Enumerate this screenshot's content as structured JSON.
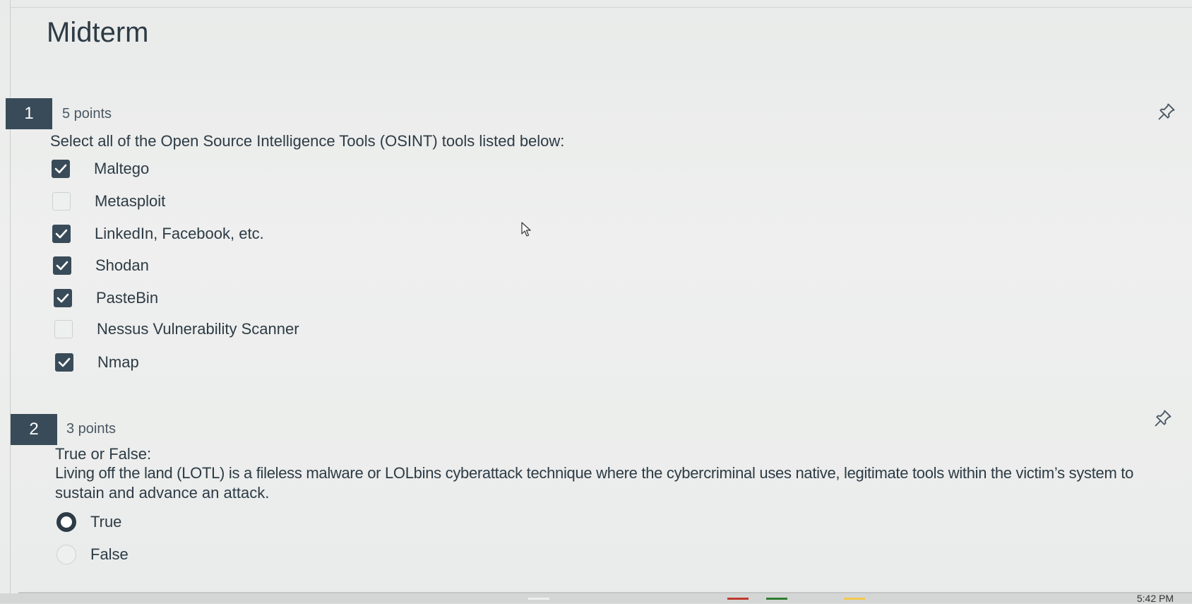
{
  "quiz": {
    "title": "Midterm"
  },
  "questions": [
    {
      "number": "1",
      "points": "5 points",
      "prompt": "Select all of the Open Source Intelligence Tools (OSINT) tools listed below:",
      "type": "checkbox",
      "options": [
        {
          "label": "Maltego",
          "checked": true
        },
        {
          "label": "Metasploit",
          "checked": false
        },
        {
          "label": "LinkedIn, Facebook, etc.",
          "checked": true
        },
        {
          "label": "Shodan",
          "checked": true
        },
        {
          "label": "PasteBin",
          "checked": true
        },
        {
          "label": "Nessus Vulnerability Scanner",
          "checked": false
        },
        {
          "label": "Nmap",
          "checked": true
        }
      ]
    },
    {
      "number": "2",
      "points": "3 points",
      "prompt_line1": "True or False:",
      "prompt_line2": "Living off the land (LOTL) is a fileless malware or LOLbins cyberattack technique where the cybercriminal uses native, legitimate tools within the victim’s system to",
      "prompt_line3": "sustain and advance an attack.",
      "type": "radio",
      "options": [
        {
          "label": "True",
          "selected": true
        },
        {
          "label": "False",
          "selected": false
        }
      ]
    }
  ],
  "icons": {
    "pin": "pin-icon",
    "check": "checkmark-icon",
    "cursor": "mouse-pointer-icon"
  },
  "taskbar": {
    "clock": "5:42 PM"
  },
  "colors": {
    "question_badge": "#394b58",
    "text": "#2d3b45",
    "checked_box": "#394b58"
  }
}
